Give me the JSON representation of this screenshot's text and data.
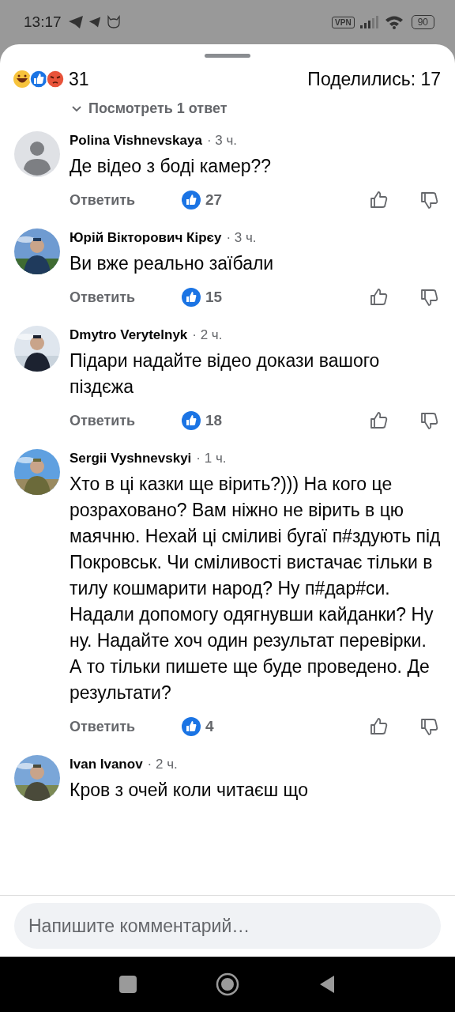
{
  "status_bar": {
    "time": "13:17",
    "vpn": "VPN",
    "battery": "90"
  },
  "header": {
    "reactions_count": "31",
    "shares": "Поделились: 17",
    "view_replies": "Посмотреть 1 ответ"
  },
  "comments": [
    {
      "author": "Polina Vishnevskaya",
      "time": "· 3 ч.",
      "text": "Де відео з боді камер??",
      "avatar": {
        "kind": "default"
      },
      "reply": "Ответить",
      "likes": "27"
    },
    {
      "author": "Юрій Вікторович Кірєу",
      "time": "· 3 ч.",
      "text": "Ви вже реально заїбали",
      "reply": "Ответить",
      "likes": "15"
    },
    {
      "author": "Dmytro Verytelnyk",
      "time": "· 2 ч.",
      "text": "Підари надайте відео докази вашого піздєжа",
      "reply": "Ответить",
      "likes": "18"
    },
    {
      "author": "Sergii Vyshnevskyi",
      "time": "· 1 ч.",
      "text": "Хто в ці казки ще вірить?))) На кого це розраховано?  Вам ніжно не вірить в цю маячню. Нехай ці сміливі бугаї п#здують під Покровськ. Чи сміливості вистачає тільки в тилу кошмарити народ? Ну п#дар#си. Надали допомогу одягнувши кайданки? Ну ну. Надайте хоч один результат перевірки. А то тільки пишете ще буде проведено. Де результати?",
      "reply": "Ответить",
      "likes": "4"
    },
    {
      "author": "Ivan Ivanov",
      "time": "· 2 ч.",
      "text": "Кров з очей коли читаєш що"
    }
  ],
  "composer": {
    "placeholder": "Напишите комментарий…"
  }
}
